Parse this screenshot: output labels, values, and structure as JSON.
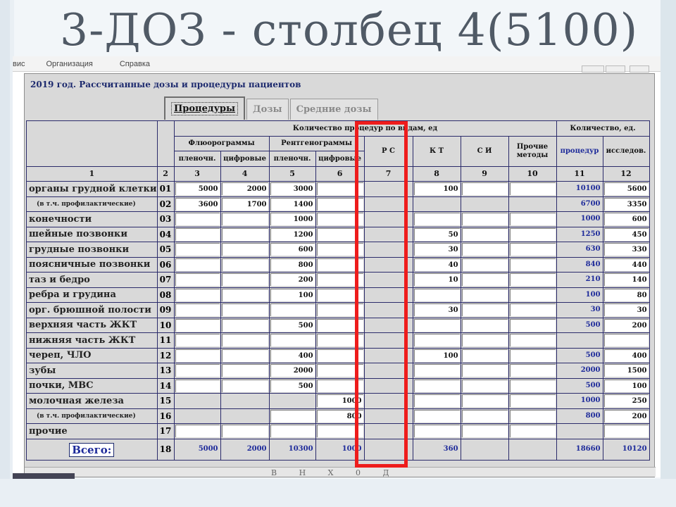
{
  "slide": {
    "title": "3-ДОЗ - столбец 4(5100)"
  },
  "menu": [
    "вис",
    "Организация",
    "Справка"
  ],
  "window": {
    "title": "2019 год.   Рассчитанные дозы и процедуры пациентов"
  },
  "tabs": [
    {
      "label": "Процедуры",
      "active": true
    },
    {
      "label": "Дозы",
      "active": false
    },
    {
      "label": "Средние дозы",
      "active": false
    }
  ],
  "header": {
    "group_procedures": "Количество процедур по видам, ед",
    "group_count": "Количество, ед.",
    "fluoro": "Флюорограммы",
    "rentgen": "Рентгенограммы",
    "film": "пленочн.",
    "digital": "цифровые",
    "rs": "Р С",
    "kt": "К Т",
    "si": "С И",
    "other": "Прочие методы",
    "procedures": "процедур",
    "studies": "исследов.",
    "colnums": [
      "1",
      "2",
      "3",
      "4",
      "5",
      "6",
      "7",
      "8",
      "9",
      "10",
      "11",
      "12"
    ]
  },
  "rows": [
    {
      "label": "органы грудной клетки",
      "num": "01",
      "v": [
        "5000",
        "2000",
        "3000",
        "",
        "",
        "100",
        "",
        "",
        "10100",
        "5600"
      ],
      "sub": false
    },
    {
      "label": "(в т.ч. профилактические)",
      "num": "02",
      "v": [
        "3600",
        "1700",
        "1400",
        "",
        "",
        "",
        "",
        "",
        "6700",
        "3350"
      ],
      "sub": true
    },
    {
      "label": "конечности",
      "num": "03",
      "v": [
        "",
        "",
        "1000",
        "",
        "",
        "",
        "",
        "",
        "1000",
        "600"
      ],
      "sub": false
    },
    {
      "label": "шейные позвонки",
      "num": "04",
      "v": [
        "",
        "",
        "1200",
        "",
        "",
        "50",
        "",
        "",
        "1250",
        "450"
      ],
      "sub": false
    },
    {
      "label": "грудные позвонки",
      "num": "05",
      "v": [
        "",
        "",
        "600",
        "",
        "",
        "30",
        "",
        "",
        "630",
        "330"
      ],
      "sub": false
    },
    {
      "label": "поясничные позвонки",
      "num": "06",
      "v": [
        "",
        "",
        "800",
        "",
        "",
        "40",
        "",
        "",
        "840",
        "440"
      ],
      "sub": false
    },
    {
      "label": "таз и бедро",
      "num": "07",
      "v": [
        "",
        "",
        "200",
        "",
        "",
        "10",
        "",
        "",
        "210",
        "140"
      ],
      "sub": false
    },
    {
      "label": "ребра и грудина",
      "num": "08",
      "v": [
        "",
        "",
        "100",
        "",
        "",
        "",
        "",
        "",
        "100",
        "80"
      ],
      "sub": false
    },
    {
      "label": "орг. брюшной полости",
      "num": "09",
      "v": [
        "",
        "",
        "",
        "",
        "",
        "30",
        "",
        "",
        "30",
        "30"
      ],
      "sub": false
    },
    {
      "label": "верхняя часть ЖКТ",
      "num": "10",
      "v": [
        "",
        "",
        "500",
        "",
        "",
        "",
        "",
        "",
        "500",
        "200"
      ],
      "sub": false
    },
    {
      "label": "нижняя часть ЖКТ",
      "num": "11",
      "v": [
        "",
        "",
        "",
        "",
        "",
        "",
        "",
        "",
        "",
        ""
      ],
      "sub": false
    },
    {
      "label": "череп, ЧЛО",
      "num": "12",
      "v": [
        "",
        "",
        "400",
        "",
        "",
        "100",
        "",
        "",
        "500",
        "400"
      ],
      "sub": false
    },
    {
      "label": "зубы",
      "num": "13",
      "v": [
        "",
        "",
        "2000",
        "",
        "",
        "",
        "",
        "",
        "2000",
        "1500"
      ],
      "sub": false
    },
    {
      "label": "почки, МВС",
      "num": "14",
      "v": [
        "",
        "",
        "500",
        "",
        "",
        "",
        "",
        "",
        "500",
        "100"
      ],
      "sub": false
    },
    {
      "label": "молочная железа",
      "num": "15",
      "v": [
        "",
        "",
        "",
        "1000",
        "",
        "",
        "",
        "",
        "1000",
        "250"
      ],
      "sub": false
    },
    {
      "label": "(в т.ч. профилактические)",
      "num": "16",
      "v": [
        "",
        "",
        "",
        "800",
        "",
        "",
        "",
        "",
        "800",
        "200"
      ],
      "sub": true
    },
    {
      "label": "прочие",
      "num": "17",
      "v": [
        "",
        "",
        "",
        "",
        "",
        "",
        "",
        "",
        "",
        ""
      ],
      "sub": false
    }
  ],
  "total": {
    "label": "Всего:",
    "num": "18",
    "v": [
      "5000",
      "2000",
      "10300",
      "1000",
      "",
      "360",
      "",
      "",
      "18660",
      "10120"
    ]
  },
  "footer_text": "В Н Х 0 Д"
}
